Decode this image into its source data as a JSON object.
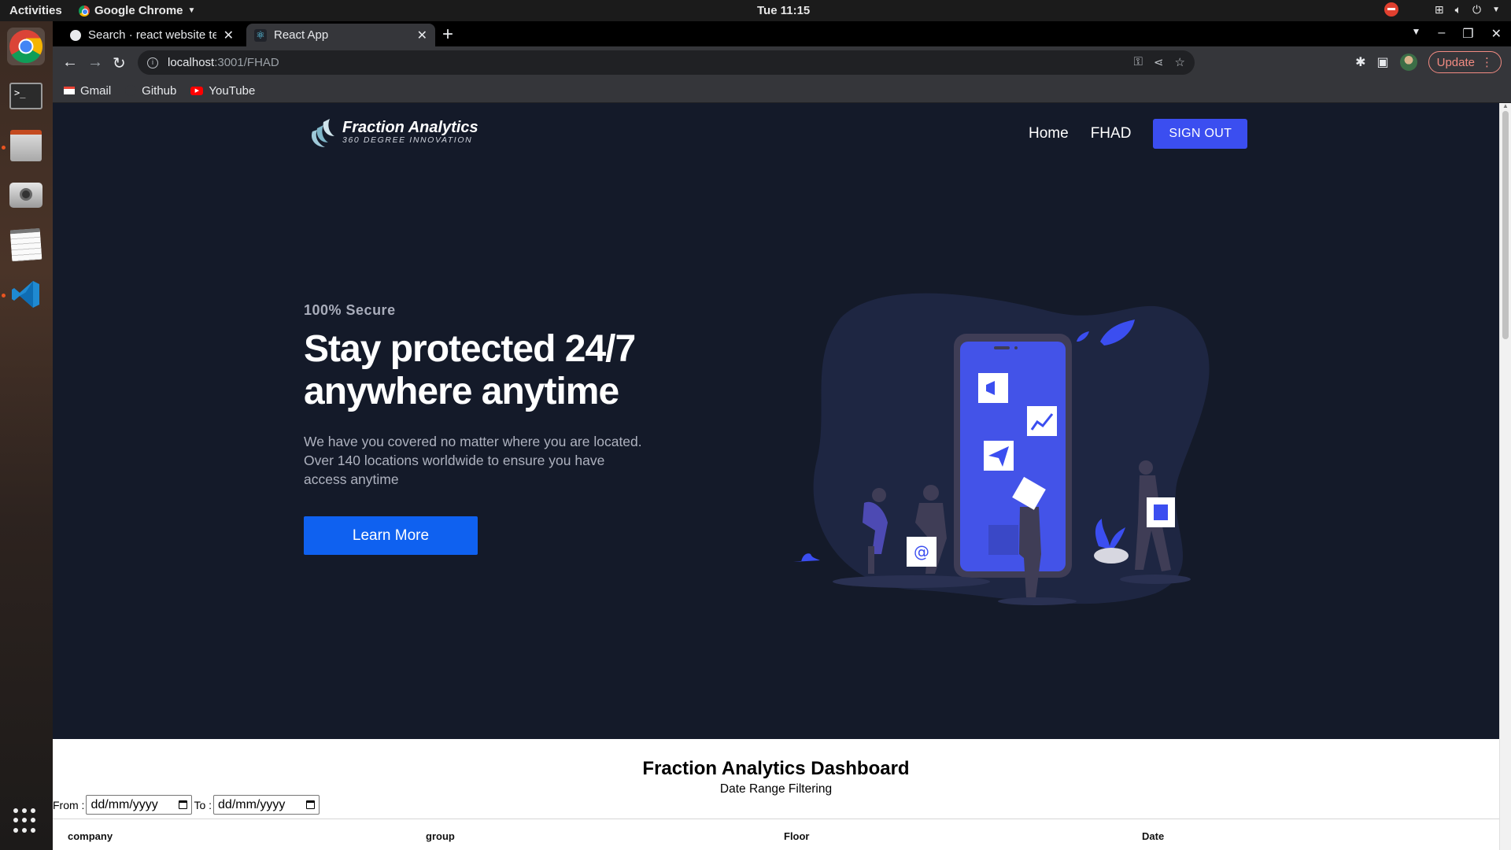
{
  "system": {
    "activities": "Activities",
    "app_name": "Google Chrome",
    "clock": "Tue 11:15"
  },
  "browser": {
    "tabs": [
      {
        "title": "Search · react website ten",
        "active": false
      },
      {
        "title": "React App",
        "active": true
      }
    ],
    "url_host": "localhost",
    "url_path": ":3001/FHAD",
    "update_label": "Update",
    "bookmarks": [
      {
        "label": "Gmail",
        "icon": "gmail-icon"
      },
      {
        "label": "Github",
        "icon": "github-icon"
      },
      {
        "label": "YouTube",
        "icon": "youtube-icon"
      }
    ]
  },
  "site": {
    "logo_name": "Fraction Analytics",
    "logo_tagline": "360 DEGREE INNOVATION",
    "nav": {
      "home": "Home",
      "fhad": "FHAD",
      "signout": "SIGN OUT"
    },
    "hero": {
      "eyebrow": "100% Secure",
      "headline": "Stay protected 24/7 anywhere anytime",
      "body": "We have you covered no matter where you are located. Over 140 locations worldwide to ensure you have access anytime",
      "cta": "Learn More"
    },
    "colors": {
      "hero_bg": "#141a29",
      "accent": "#3b4ef0",
      "cta": "#0f61f0"
    }
  },
  "dashboard": {
    "title": "Fraction Analytics Dashboard",
    "subtitle": "Date Range Filtering",
    "from_label": "From :",
    "to_label": "To :",
    "from_value": "dd/mm/yyyy",
    "to_value": "dd/mm/yyyy",
    "columns": [
      "company",
      "group",
      "Floor",
      "Date"
    ]
  }
}
